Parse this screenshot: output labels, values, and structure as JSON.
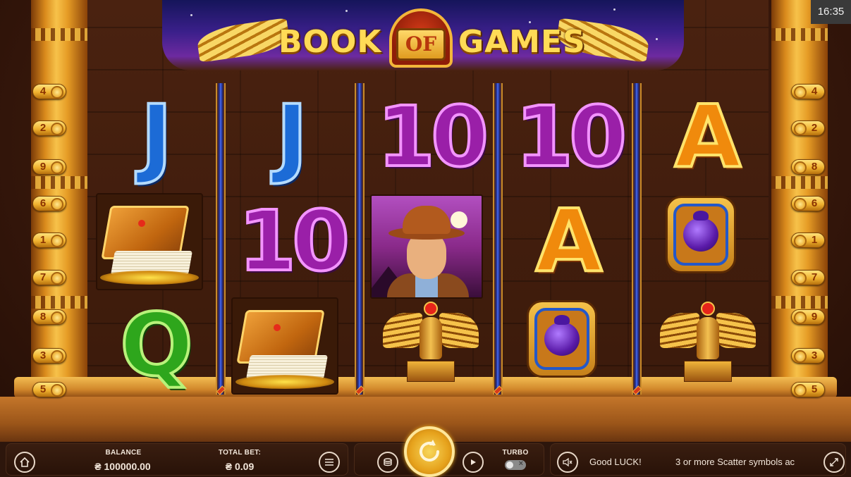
{
  "game": {
    "title_part1": "BOOK",
    "title_part2": "OF",
    "title_part3": "GAMES"
  },
  "clock": "16:35",
  "paylines": {
    "left": [
      "4",
      "2",
      "9",
      "6",
      "1",
      "7",
      "8",
      "3",
      "5"
    ],
    "right": [
      "4",
      "2",
      "8",
      "6",
      "1",
      "7",
      "9",
      "3",
      "5"
    ]
  },
  "reels": [
    {
      "symbols": [
        "J",
        "book",
        "Q"
      ]
    },
    {
      "symbols": [
        "J",
        "10",
        "book"
      ]
    },
    {
      "symbols": [
        "10",
        "explorer",
        "statue"
      ]
    },
    {
      "symbols": [
        "10",
        "A",
        "scarab"
      ]
    },
    {
      "symbols": [
        "A",
        "scarab",
        "statue"
      ]
    }
  ],
  "footer": {
    "balance_label": "BALANCE",
    "balance_value": "₴ 100000.00",
    "bet_label": "TOTAL BET:",
    "bet_value": "₴ 0.09",
    "turbo_label": "TURBO",
    "message": "Good LUCK!",
    "ticker": "3 or more Scatter symbols ac"
  },
  "icons": {
    "home": "home-icon",
    "menu": "menu-icon",
    "coins": "coins-icon",
    "spin": "spin-icon",
    "autoplay": "autoplay-icon",
    "sound": "mute-icon",
    "fullscreen": "fullscreen-icon"
  },
  "colors": {
    "accent_gold": "#f5b21a",
    "bar_bg": "#2d160c"
  }
}
